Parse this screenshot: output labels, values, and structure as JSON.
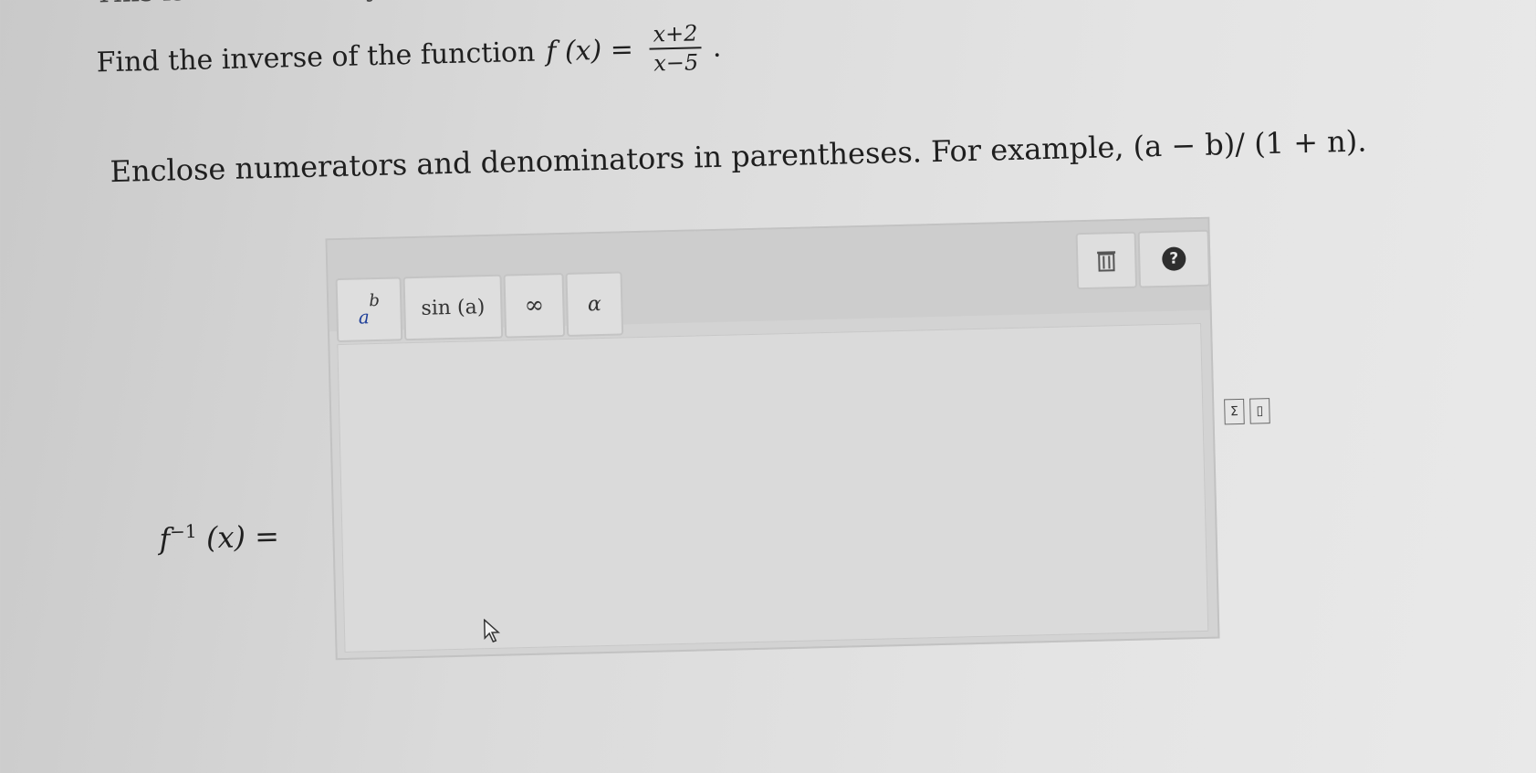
{
  "cut_text": "This is similar to Try",
  "question": {
    "prefix": "Find the inverse of the function",
    "function_name": "f (x) =",
    "numerator": "x+2",
    "denominator": "x−5",
    "suffix": "."
  },
  "instruction": "Enclose numerators and denominators in parentheses. For example, (a − b)/ (1 + n).",
  "answer": {
    "label_f": "f",
    "label_exp": "−1",
    "label_rest": " (x) ="
  },
  "toolbar": {
    "power_base": "a",
    "power_exp": "b",
    "sin_label": "sin (a)",
    "infinity_label": "∞",
    "alpha_label": "α",
    "trash_icon": "trash-icon",
    "help_symbol": "?"
  },
  "side_icons": {
    "sigma_label": "Σ",
    "doc_label": "▯"
  }
}
